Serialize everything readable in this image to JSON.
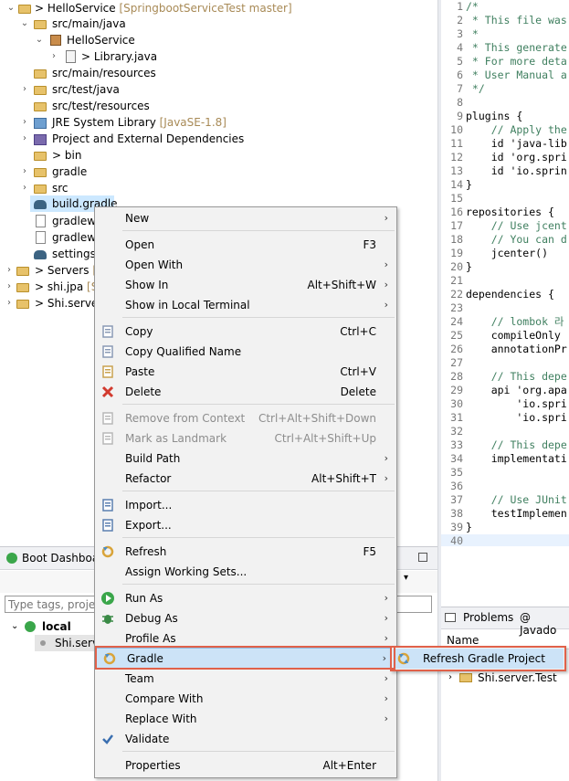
{
  "explorer": {
    "items": [
      {
        "label": "HelloService",
        "decoration": "[SpringbootServiceTest master]",
        "prefix": "> "
      },
      {
        "label": "src/main/java"
      },
      {
        "label": "HelloService"
      },
      {
        "label": "Library.java",
        "prefix": "> "
      },
      {
        "label": "src/main/resources"
      },
      {
        "label": "src/test/java"
      },
      {
        "label": "src/test/resources"
      },
      {
        "label": "JRE System Library",
        "decoration": "[JavaSE-1.8]"
      },
      {
        "label": "Project and External Dependencies"
      },
      {
        "label": "bin",
        "prefix": "> "
      },
      {
        "label": "gradle"
      },
      {
        "label": "src"
      },
      {
        "label": "build.gradle"
      },
      {
        "label": "gradlew"
      },
      {
        "label": "gradlew."
      },
      {
        "label": "settings."
      },
      {
        "label": "Servers",
        "decoration": "[S",
        "prefix": "> "
      },
      {
        "label": "shi.jpa",
        "decoration": "[S",
        "prefix": "> "
      },
      {
        "label": "Shi.server",
        "prefix": "> "
      }
    ]
  },
  "editor": {
    "lines": [
      {
        "n": "1",
        "text": "/*",
        "cls": "cm"
      },
      {
        "n": "2",
        "text": " * This file was",
        "cls": "cm"
      },
      {
        "n": "3",
        "text": " *",
        "cls": "cm"
      },
      {
        "n": "4",
        "text": " * This generate",
        "cls": "cm"
      },
      {
        "n": "5",
        "text": " * For more deta",
        "cls": "cm"
      },
      {
        "n": "6",
        "text": " * User Manual a",
        "cls": "cm"
      },
      {
        "n": "7",
        "text": " */",
        "cls": "cm"
      },
      {
        "n": "8",
        "text": "",
        "cls": ""
      },
      {
        "n": "9",
        "text": "plugins {",
        "cls": ""
      },
      {
        "n": "10",
        "text": "    // Apply the",
        "cls": "cm"
      },
      {
        "n": "11",
        "text": "    id 'java-lib",
        "cls": ""
      },
      {
        "n": "12",
        "text": "    id 'org.spri",
        "cls": ""
      },
      {
        "n": "13",
        "text": "    id 'io.sprin",
        "cls": ""
      },
      {
        "n": "14",
        "text": "}",
        "cls": ""
      },
      {
        "n": "15",
        "text": "",
        "cls": ""
      },
      {
        "n": "16",
        "text": "repositories {",
        "cls": ""
      },
      {
        "n": "17",
        "text": "    // Use jcent",
        "cls": "cm"
      },
      {
        "n": "18",
        "text": "    // You can d",
        "cls": "cm"
      },
      {
        "n": "19",
        "text": "    jcenter()",
        "cls": ""
      },
      {
        "n": "20",
        "text": "}",
        "cls": ""
      },
      {
        "n": "21",
        "text": "",
        "cls": ""
      },
      {
        "n": "22",
        "text": "dependencies {",
        "cls": ""
      },
      {
        "n": "23",
        "text": "",
        "cls": ""
      },
      {
        "n": "24",
        "text": "    // lombok 라",
        "cls": "cm"
      },
      {
        "n": "25",
        "text": "    compileOnly ",
        "cls": ""
      },
      {
        "n": "26",
        "text": "    annotationPr",
        "cls": ""
      },
      {
        "n": "27",
        "text": "",
        "cls": ""
      },
      {
        "n": "28",
        "text": "    // This depe",
        "cls": "cm"
      },
      {
        "n": "29",
        "text": "    api 'org.apa",
        "cls": ""
      },
      {
        "n": "30",
        "text": "        'io.spri",
        "cls": ""
      },
      {
        "n": "31",
        "text": "        'io.spri",
        "cls": ""
      },
      {
        "n": "32",
        "text": "",
        "cls": ""
      },
      {
        "n": "33",
        "text": "    // This depe",
        "cls": "cm"
      },
      {
        "n": "34",
        "text": "    implementati",
        "cls": ""
      },
      {
        "n": "35",
        "text": "",
        "cls": ""
      },
      {
        "n": "36",
        "text": "",
        "cls": ""
      },
      {
        "n": "37",
        "text": "    // Use JUnit",
        "cls": "cm"
      },
      {
        "n": "38",
        "text": "    testImplemen",
        "cls": ""
      },
      {
        "n": "39",
        "text": "}",
        "cls": ""
      },
      {
        "n": "40",
        "text": "",
        "cls": "hl"
      }
    ]
  },
  "boot_dashboard": {
    "tab_label": "Boot Dashboa",
    "filter_placeholder": "Type tags, project",
    "local_label": "local",
    "server_label": "Shi.serv"
  },
  "problems": {
    "tab_problems": "Problems",
    "tab_javadoc": "@ Javado",
    "col_name": "Name",
    "row_label": "Shi.server.Test"
  },
  "context_menu": {
    "items": [
      {
        "label": "New",
        "shortcut": "",
        "submenu": true
      },
      {
        "label": "Open",
        "shortcut": "F3"
      },
      {
        "label": "Open With",
        "shortcut": "",
        "submenu": true
      },
      {
        "label": "Show In",
        "shortcut": "Alt+Shift+W",
        "submenu": true
      },
      {
        "label": "Show in Local Terminal",
        "shortcut": "",
        "submenu": true
      },
      {
        "label": "Copy",
        "shortcut": "Ctrl+C"
      },
      {
        "label": "Copy Qualified Name",
        "shortcut": ""
      },
      {
        "label": "Paste",
        "shortcut": "Ctrl+V"
      },
      {
        "label": "Delete",
        "shortcut": "Delete"
      },
      {
        "label": "Remove from Context",
        "shortcut": "Ctrl+Alt+Shift+Down"
      },
      {
        "label": "Mark as Landmark",
        "shortcut": "Ctrl+Alt+Shift+Up"
      },
      {
        "label": "Build Path",
        "shortcut": "",
        "submenu": true
      },
      {
        "label": "Refactor",
        "shortcut": "Alt+Shift+T",
        "submenu": true
      },
      {
        "label": "Import...",
        "shortcut": ""
      },
      {
        "label": "Export...",
        "shortcut": ""
      },
      {
        "label": "Refresh",
        "shortcut": "F5"
      },
      {
        "label": "Assign Working Sets...",
        "shortcut": ""
      },
      {
        "label": "Run As",
        "shortcut": "",
        "submenu": true
      },
      {
        "label": "Debug As",
        "shortcut": "",
        "submenu": true
      },
      {
        "label": "Profile As",
        "shortcut": "",
        "submenu": true
      },
      {
        "label": "Gradle",
        "shortcut": "",
        "submenu": true
      },
      {
        "label": "Team",
        "shortcut": "",
        "submenu": true
      },
      {
        "label": "Compare With",
        "shortcut": "",
        "submenu": true
      },
      {
        "label": "Replace With",
        "shortcut": "",
        "submenu": true
      },
      {
        "label": "Validate",
        "shortcut": ""
      },
      {
        "label": "Properties",
        "shortcut": "Alt+Enter"
      }
    ],
    "arrow": "›"
  },
  "gradle_submenu": {
    "refresh_label": "Refresh Gradle Project"
  },
  "colors": {
    "highlight": "#cce3f7",
    "annotation_red": "#e0614a",
    "comment_green": "#3f7f5f",
    "string_blue": "#2a00ff"
  }
}
